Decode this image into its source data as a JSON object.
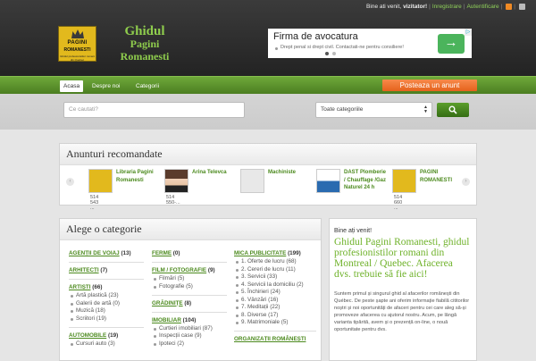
{
  "top_bar": {
    "greeting": "Bine ati venit,",
    "user": "vizitator!",
    "register": "Inregistrare",
    "login": "Autentificare",
    "icons": [
      "rss-icon",
      "twitter-icon"
    ]
  },
  "logo": {
    "line1": "PAGINI",
    "line2": "ROMANESTI",
    "line3": "Ghidul profesionistilor romani din Quebec"
  },
  "site_name": {
    "line1": "Ghidul",
    "line2": "Pagini",
    "line3": "Romanesti"
  },
  "ad": {
    "title": "Firma de avocatura",
    "subtitle": "Drept penal si drept civil. Contactati-ne pentru consiliere!",
    "go_arrow": "→",
    "close": "▷"
  },
  "nav": {
    "items": [
      "Acasa",
      "Despre noi",
      "Categorii"
    ],
    "post_ad": "Posteaza un anunt"
  },
  "search": {
    "placeholder": "Ce cautati?",
    "category_value": "Toate categoriile"
  },
  "featured": {
    "title": "Anunturi recomandate",
    "prev": "‹",
    "next": "›",
    "items": [
      {
        "name": "Libraria Pagini Romanesti",
        "phone": "514 543 ..."
      },
      {
        "name": "Arina Televca",
        "phone": "514 550-..."
      },
      {
        "name": "Machiniste",
        "phone": ""
      },
      {
        "name": "DAST Plomberie / Chauffage /Gaz Naturel 24 h",
        "phone": ""
      },
      {
        "name": "PAGINI ROMANESTI",
        "phone": "514 660 ..."
      }
    ]
  },
  "categories": {
    "title": "Alege o categorie",
    "col1": [
      {
        "name": "AGENȚII DE VOIAJ",
        "count": "(13)"
      },
      {
        "name": "ARHITECȚI",
        "count": "(7)"
      },
      {
        "name": "ARTIȘTI",
        "count": "(66)",
        "subs": [
          "Artă plastică (23)",
          "Galerii de artă (0)",
          "Muzică (18)",
          "Scriitori (19)"
        ]
      },
      {
        "name": "AUTOMOBILE",
        "count": "(19)",
        "subs": [
          "Cursuri auto (3)"
        ]
      }
    ],
    "col2": [
      {
        "name": "FERME",
        "count": "(0)"
      },
      {
        "name": "FILM / FOTOGRAFIE",
        "count": "(9)",
        "subs": [
          "Filmări (5)",
          "Fotografie (5)"
        ]
      },
      {
        "name": "GRĂDINIȚE",
        "count": "(8)"
      },
      {
        "name": "IMOBILIAR",
        "count": "(104)",
        "subs": [
          "Curtieri imobiliari (87)",
          "Inspecții case (9)",
          "Ipoteci (2)"
        ]
      }
    ],
    "col3": [
      {
        "name": "MICA PUBLICITATE",
        "count": "(199)",
        "subs": [
          "1. Oferte de lucru (68)",
          "2. Cereri de lucru (11)",
          "3. Servicii (33)",
          "4. Servicii la domiciliu (2)",
          "5. Închirieri (24)",
          "6. Vânzări (16)",
          "7. Meditații (22)",
          "8. Diverse (17)",
          "9. Matrimoniale (5)"
        ]
      },
      {
        "name": "ORGANIZAȚII ROMÂNEȘTI",
        "count": ""
      }
    ]
  },
  "welcome": {
    "hello": "Bine ați venit!",
    "headline": "Ghidul Pagini Romanesti, ghidul profesionistilor romani din Montreal / Quebec. Afacerea dvs. trebuie să fie aici!",
    "body": "Suntem primul și singurul ghid al afacerilor românești din Québec. De peste șapte ani oferim informație fiabilă cititorilor noștri și noi oportunități de afaceri pentru cei care aleg să-și promoveze afacerea cu ajutorul nostru. Acum, pe lângă varianta tipărită, avem și o prezență on-line, o nouă oportunitate pentru dvs."
  },
  "colors": {
    "accent_green": "#5e9a2b",
    "link_green": "#4c8a1e",
    "orange": "#ec6b25",
    "header_dark": "#2e2e2e"
  }
}
